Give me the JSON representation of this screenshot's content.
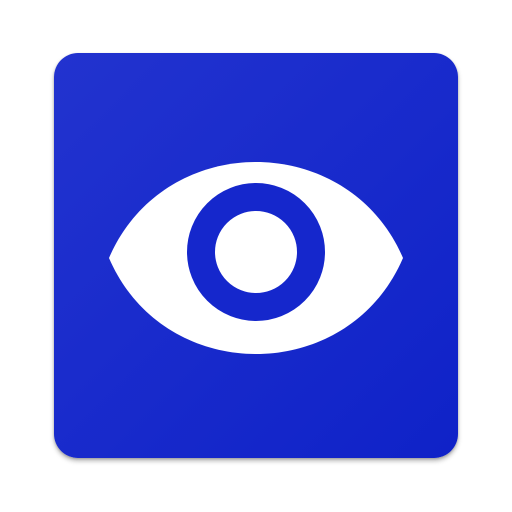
{
  "icon": {
    "name": "eye-icon",
    "colors": {
      "background_start": "#2233cf",
      "background_end": "#0f22c8",
      "eye_fill": "#ffffff",
      "iris_ring": "#1527cc"
    }
  }
}
